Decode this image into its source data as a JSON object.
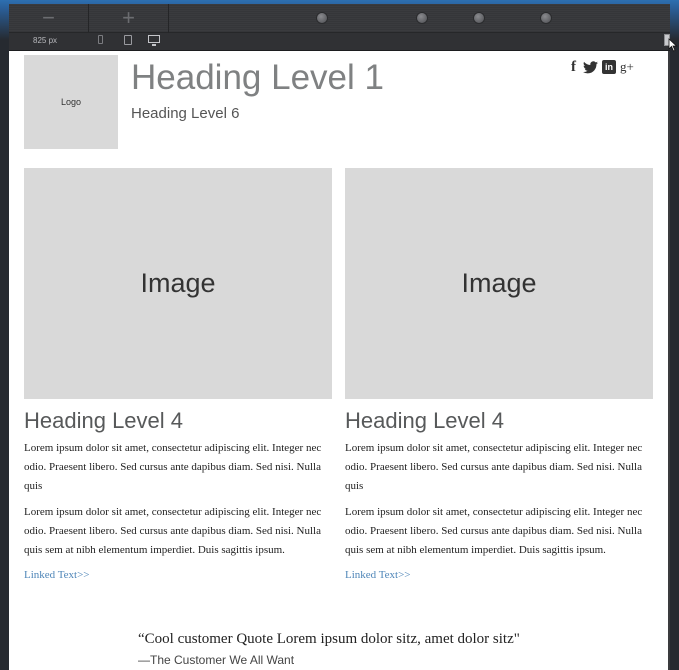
{
  "toolbar": {
    "zoom_out_label": "−",
    "zoom_in_label": "+",
    "width_readout": "825 px"
  },
  "header": {
    "logo_text": "Logo",
    "heading_level_1": "Heading Level 1",
    "heading_level_6": "Heading Level 6",
    "social": {
      "facebook": "f",
      "linkedin": "in",
      "googleplus": "g+"
    }
  },
  "columns": [
    {
      "image_text": "Image",
      "heading": "Heading Level 4",
      "para1": "Lorem ipsum dolor sit amet, consectetur adipiscing elit. Integer nec odio. Praesent libero. Sed cursus ante dapibus diam. Sed nisi. Nulla quis",
      "para2": "Lorem ipsum dolor sit amet, consectetur adipiscing elit. Integer nec odio. Praesent libero. Sed cursus ante dapibus diam. Sed nisi. Nulla quis sem at nibh elementum imperdiet. Duis sagittis ipsum.",
      "link": "Linked Text>>"
    },
    {
      "image_text": "Image",
      "heading": "Heading Level 4",
      "para1": "Lorem ipsum dolor sit amet, consectetur adipiscing elit. Integer nec odio. Praesent libero. Sed cursus ante dapibus diam. Sed nisi. Nulla quis",
      "para2": "Lorem ipsum dolor sit amet, consectetur adipiscing elit. Integer nec odio. Praesent libero. Sed cursus ante dapibus diam. Sed nisi. Nulla quis sem at nibh elementum imperdiet. Duis sagittis ipsum.",
      "link": "Linked Text>>"
    }
  ],
  "quote": {
    "text": "“Cool customer Quote Lorem ipsum dolor sitz, amet dolor sitz\"",
    "author": "—The Customer We All Want"
  },
  "colors": {
    "link": "#4f86b8",
    "placeholder": "#d9d9d9",
    "heading": "#7f8182"
  }
}
